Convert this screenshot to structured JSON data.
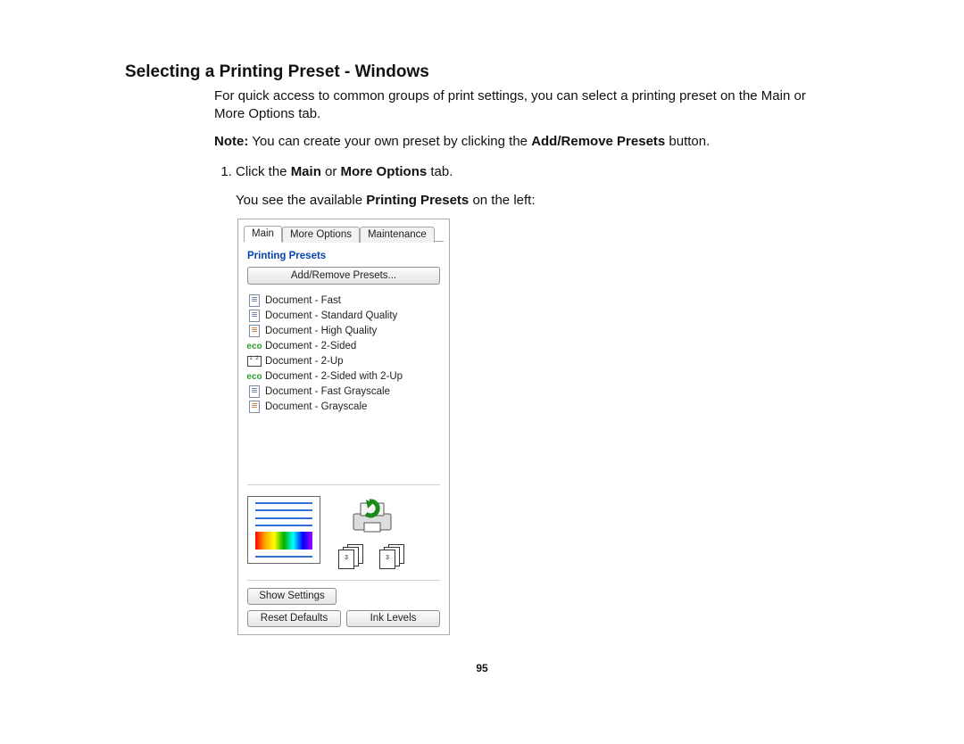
{
  "heading": "Selecting a Printing Preset - Windows",
  "intro": "For quick access to common groups of print settings, you can select a printing preset on the Main or More Options tab.",
  "note_label": "Note:",
  "note_text": " You can create your own preset by clicking the ",
  "note_bold": "Add/Remove Presets",
  "note_tail": " button.",
  "step1_pre": "Click the ",
  "step1_b1": "Main",
  "step1_mid": " or ",
  "step1_b2": "More Options",
  "step1_post": " tab.",
  "step1_see_pre": "You see the available ",
  "step1_see_b": "Printing Presets",
  "step1_see_post": " on the left:",
  "page_number": "95",
  "panel": {
    "tabs": {
      "main": "Main",
      "more": "More Options",
      "maint": "Maintenance"
    },
    "section_title": "Printing Presets",
    "add_remove_btn": "Add/Remove Presets...",
    "presets": [
      {
        "label": "Document - Fast",
        "icon": "doc"
      },
      {
        "label": "Document - Standard Quality",
        "icon": "doc"
      },
      {
        "label": "Document - High Quality",
        "icon": "doc-hq"
      },
      {
        "label": "Document - 2-Sided",
        "icon": "eco"
      },
      {
        "label": "Document - 2-Up",
        "icon": "2up"
      },
      {
        "label": "Document - 2-Sided with 2-Up",
        "icon": "eco"
      },
      {
        "label": "Document - Fast Grayscale",
        "icon": "doc"
      },
      {
        "label": "Document - Grayscale",
        "icon": "doc-hq"
      }
    ],
    "show_settings_btn": "Show Settings",
    "reset_defaults_btn": "Reset Defaults",
    "ink_levels_btn": "Ink Levels"
  }
}
